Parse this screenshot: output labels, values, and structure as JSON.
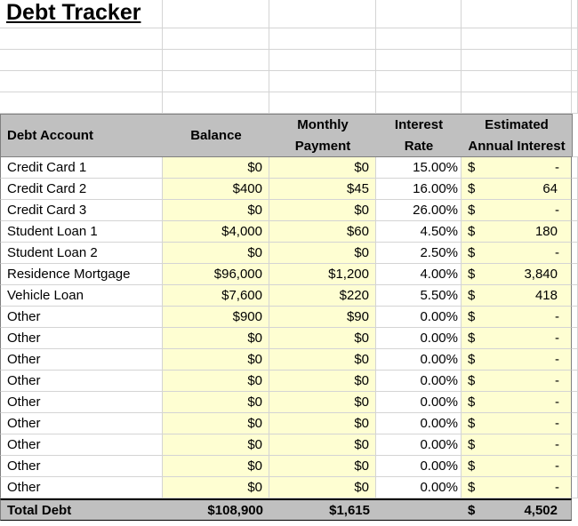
{
  "title": "Debt Tracker",
  "headers": {
    "account": "Debt Account",
    "balance": "Balance",
    "payment_line1": "Monthly",
    "payment_line2": "Payment",
    "rate_line1": "Interest",
    "rate_line2": "Rate",
    "est_line1": "Estimated",
    "est_line2": "Annual Interest"
  },
  "rows": [
    {
      "account": "Credit Card 1",
      "balance": "$0",
      "payment": "$0",
      "rate": "15.00%",
      "currency": "$",
      "interest": "-"
    },
    {
      "account": "Credit Card 2",
      "balance": "$400",
      "payment": "$45",
      "rate": "16.00%",
      "currency": "$",
      "interest": "64"
    },
    {
      "account": "Credit Card 3",
      "balance": "$0",
      "payment": "$0",
      "rate": "26.00%",
      "currency": "$",
      "interest": "-"
    },
    {
      "account": "Student Loan 1",
      "balance": "$4,000",
      "payment": "$60",
      "rate": "4.50%",
      "currency": "$",
      "interest": "180"
    },
    {
      "account": "Student Loan 2",
      "balance": "$0",
      "payment": "$0",
      "rate": "2.50%",
      "currency": "$",
      "interest": "-"
    },
    {
      "account": "Residence Mortgage",
      "balance": "$96,000",
      "payment": "$1,200",
      "rate": "4.00%",
      "currency": "$",
      "interest": "3,840"
    },
    {
      "account": "Vehicle Loan",
      "balance": "$7,600",
      "payment": "$220",
      "rate": "5.50%",
      "currency": "$",
      "interest": "418"
    },
    {
      "account": "Other",
      "balance": "$900",
      "payment": "$90",
      "rate": "0.00%",
      "currency": "$",
      "interest": "-"
    },
    {
      "account": "Other",
      "balance": "$0",
      "payment": "$0",
      "rate": "0.00%",
      "currency": "$",
      "interest": "-"
    },
    {
      "account": "Other",
      "balance": "$0",
      "payment": "$0",
      "rate": "0.00%",
      "currency": "$",
      "interest": "-"
    },
    {
      "account": "Other",
      "balance": "$0",
      "payment": "$0",
      "rate": "0.00%",
      "currency": "$",
      "interest": "-"
    },
    {
      "account": "Other",
      "balance": "$0",
      "payment": "$0",
      "rate": "0.00%",
      "currency": "$",
      "interest": "-"
    },
    {
      "account": "Other",
      "balance": "$0",
      "payment": "$0",
      "rate": "0.00%",
      "currency": "$",
      "interest": "-"
    },
    {
      "account": "Other",
      "balance": "$0",
      "payment": "$0",
      "rate": "0.00%",
      "currency": "$",
      "interest": "-"
    },
    {
      "account": "Other",
      "balance": "$0",
      "payment": "$0",
      "rate": "0.00%",
      "currency": "$",
      "interest": "-"
    },
    {
      "account": "Other",
      "balance": "$0",
      "payment": "$0",
      "rate": "0.00%",
      "currency": "$",
      "interest": "-"
    }
  ],
  "total": {
    "label": "Total Debt",
    "balance": "$108,900",
    "payment": "$1,615",
    "currency": "$",
    "interest": "4,502"
  },
  "colors": {
    "input_fill": "#fefed2",
    "header_fill": "#c0c0c0",
    "gridline": "#d4d4d4"
  }
}
